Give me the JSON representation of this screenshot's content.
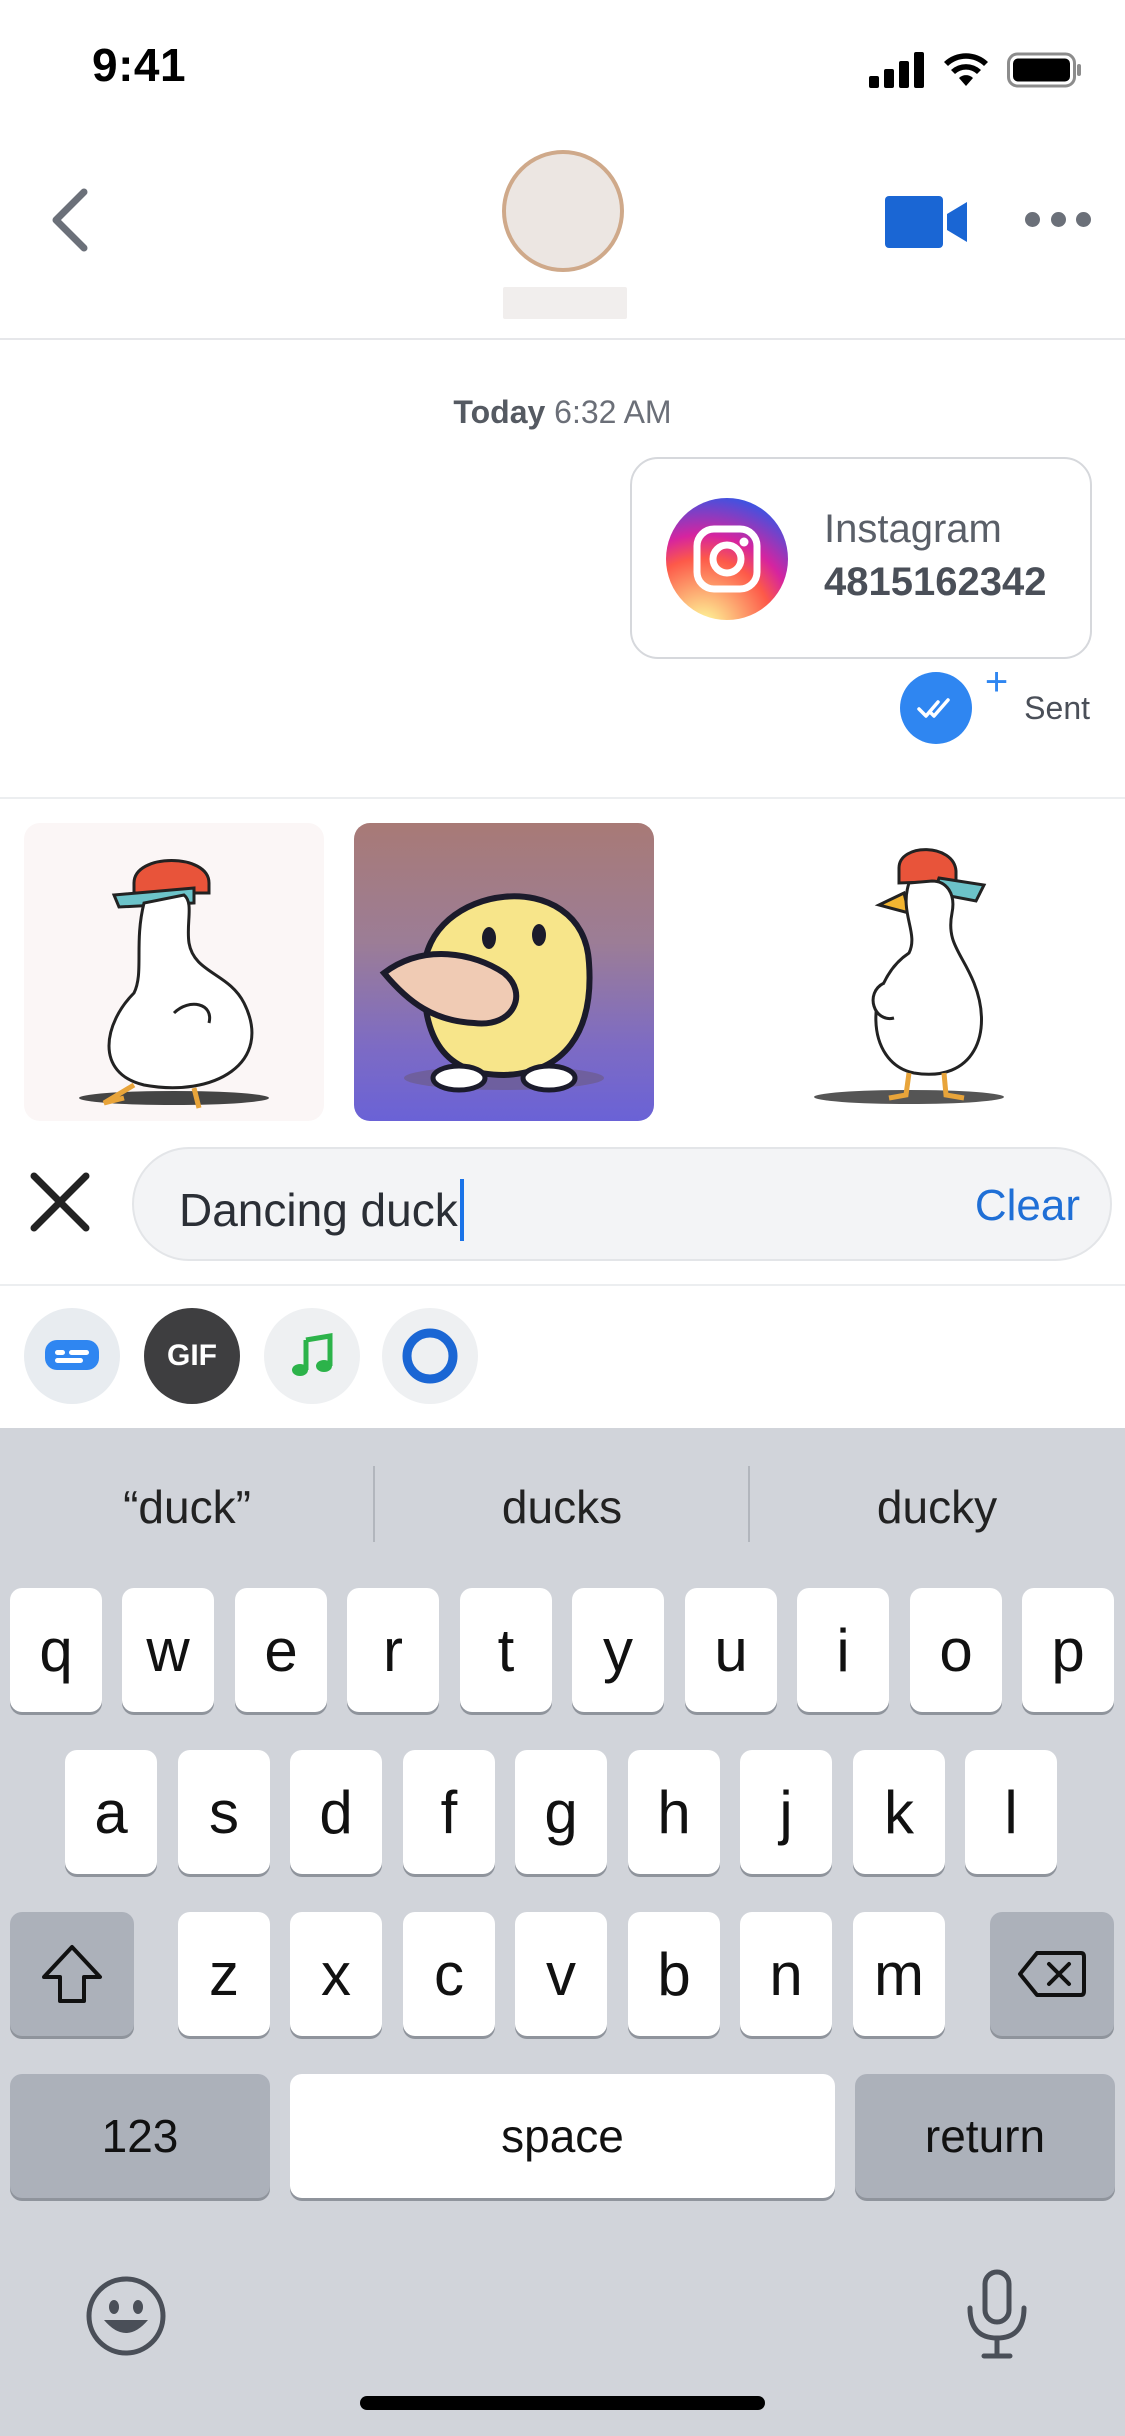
{
  "status_bar": {
    "time": "9:41"
  },
  "header": {
    "back_icon": "chevron-left-icon",
    "video_icon": "video-camera-icon",
    "more_icon": "more-horizontal-icon",
    "accent_color": "#1a66d4"
  },
  "chat": {
    "timestamp_day": "Today",
    "timestamp_time": "6:32 AM",
    "card": {
      "service": "Instagram",
      "number": "4815162342",
      "icon": "instagram-icon"
    },
    "status_label": "Sent"
  },
  "gifs": [
    {
      "name": "duck-with-cap-dancing-gif"
    },
    {
      "name": "yellow-duck-gif"
    },
    {
      "name": "duck-with-cap-walking-gif"
    }
  ],
  "search": {
    "value": "Dancing duck",
    "clear_label": "Clear"
  },
  "categories": [
    {
      "name": "sticker-category",
      "label": ""
    },
    {
      "name": "gif-category",
      "label": "GIF"
    },
    {
      "name": "music-category",
      "label": ""
    },
    {
      "name": "circle-category",
      "label": ""
    }
  ],
  "keyboard": {
    "suggestions": [
      "“duck”",
      "ducks",
      "ducky"
    ],
    "row1": [
      "q",
      "w",
      "e",
      "r",
      "t",
      "y",
      "u",
      "i",
      "o",
      "p"
    ],
    "row2": [
      "a",
      "s",
      "d",
      "f",
      "g",
      "h",
      "j",
      "k",
      "l"
    ],
    "row3": [
      "z",
      "x",
      "c",
      "v",
      "b",
      "n",
      "m"
    ],
    "numbers_label": "123",
    "space_label": "space",
    "return_label": "return"
  }
}
